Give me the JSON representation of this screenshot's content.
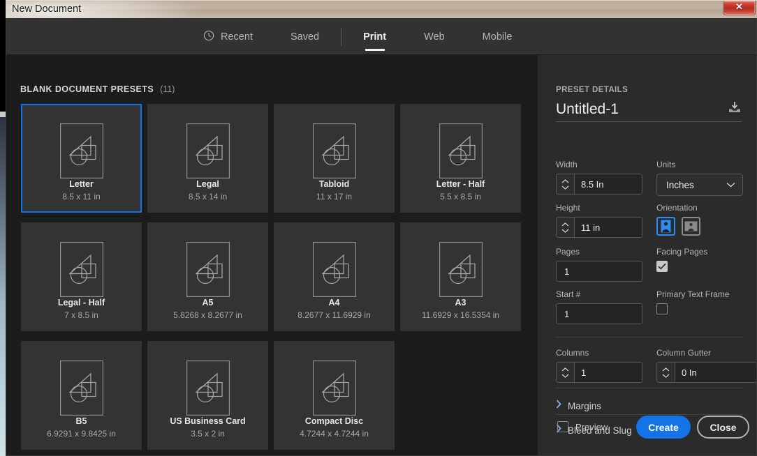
{
  "window": {
    "title": "New Document",
    "close_icon": "close-x-icon"
  },
  "tabs": [
    {
      "label": "Recent",
      "icon": "clock-icon",
      "active": false
    },
    {
      "label": "Saved",
      "icon": "",
      "active": false
    },
    {
      "label": "Print",
      "icon": "",
      "active": true
    },
    {
      "label": "Web",
      "icon": "",
      "active": false
    },
    {
      "label": "Mobile",
      "icon": "",
      "active": false
    }
  ],
  "left_panel": {
    "section_title": "BLANK DOCUMENT PRESETS",
    "count": "(11)",
    "presets": [
      {
        "name": "Letter",
        "size": "8.5 x 11 in",
        "selected": true
      },
      {
        "name": "Legal",
        "size": "8.5 x 14 in",
        "selected": false
      },
      {
        "name": "Tabloid",
        "size": "11 x 17 in",
        "selected": false
      },
      {
        "name": "Letter - Half",
        "size": "5.5 x 8.5 in",
        "selected": false
      },
      {
        "name": "Legal - Half",
        "size": "7 x 8.5 in",
        "selected": false
      },
      {
        "name": "A5",
        "size": "5.8268 x 8.2677 in",
        "selected": false
      },
      {
        "name": "A4",
        "size": "8.2677 x 11.6929 in",
        "selected": false
      },
      {
        "name": "A3",
        "size": "11.6929 x 16.5354 in",
        "selected": false
      },
      {
        "name": "B5",
        "size": "6.9291 x 9.8425 in",
        "selected": false
      },
      {
        "name": "US Business Card",
        "size": "3.5 x 2 in",
        "selected": false
      },
      {
        "name": "Compact Disc",
        "size": "4.7244 x 4.7244 in",
        "selected": false
      }
    ]
  },
  "right_panel": {
    "details_label": "PRESET DETAILS",
    "doc_name": "Untitled-1",
    "save_preset_icon": "save-preset-icon",
    "width": {
      "label": "Width",
      "value": "8.5 In"
    },
    "units": {
      "label": "Units",
      "value": "Inches"
    },
    "height": {
      "label": "Height",
      "value": "11 in"
    },
    "orientation": {
      "label": "Orientation",
      "portrait_icon": "portrait-orientation-icon",
      "landscape_icon": "landscape-orientation-icon",
      "selected": "portrait"
    },
    "pages": {
      "label": "Pages",
      "value": "1"
    },
    "facing_pages": {
      "label": "Facing Pages",
      "checked": true
    },
    "start_number": {
      "label": "Start #",
      "value": "1"
    },
    "primary_text_frame": {
      "label": "Primary Text Frame",
      "checked": false
    },
    "columns": {
      "label": "Columns",
      "value": "1"
    },
    "column_gutter": {
      "label": "Column Gutter",
      "value": "0 In"
    },
    "accordions": [
      {
        "label": "Margins",
        "icon": "chevron-right-icon",
        "expanded": false
      },
      {
        "label": "Bleed and Slug",
        "icon": "chevron-right-icon",
        "expanded": false
      }
    ],
    "preview": {
      "label": "Preview",
      "checked": false
    },
    "create_button": "Create",
    "close_button": "Close"
  },
  "colors": {
    "accent": "#1473e6",
    "panel_bg": "#2b2b2b",
    "left_bg": "#1c1c1c",
    "card_bg": "#333333",
    "tabbar_bg": "#323232"
  }
}
